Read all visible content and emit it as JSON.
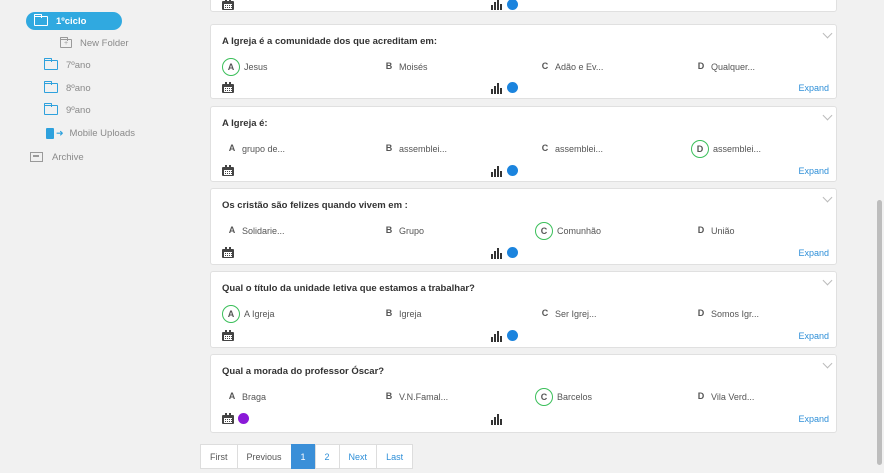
{
  "sidebar": {
    "active_folder": "1ºciclo",
    "items": [
      {
        "label": "New Folder",
        "icon": "folder-plus-icon"
      },
      {
        "label": "7ºano",
        "icon": "folder-icon"
      },
      {
        "label": "8ºano",
        "icon": "folder-icon"
      },
      {
        "label": "9ºano",
        "icon": "folder-icon"
      },
      {
        "label": "Mobile Uploads",
        "icon": "mobile-upload-icon"
      },
      {
        "label": "Archive",
        "icon": "archive-icon"
      }
    ]
  },
  "questions": [
    {
      "text": "A Igreja é a comunidade dos que acreditam em:",
      "options": [
        {
          "letter": "A",
          "text": "Jesus",
          "correct": true
        },
        {
          "letter": "B",
          "text": "Moisés",
          "correct": false
        },
        {
          "letter": "C",
          "text": "Adão e Ev...",
          "correct": false
        },
        {
          "letter": "D",
          "text": "Qualquer...",
          "correct": false
        }
      ],
      "status_dot": "blue",
      "expand": "Expand"
    },
    {
      "text": "A Igreja é:",
      "options": [
        {
          "letter": "A",
          "text": "grupo de...",
          "correct": false
        },
        {
          "letter": "B",
          "text": "assemblei...",
          "correct": false
        },
        {
          "letter": "C",
          "text": "assemblei...",
          "correct": false
        },
        {
          "letter": "D",
          "text": "assemblei...",
          "correct": true
        }
      ],
      "status_dot": "blue",
      "expand": "Expand"
    },
    {
      "text": "Os cristão são felizes quando vivem em :",
      "options": [
        {
          "letter": "A",
          "text": "Solidarie...",
          "correct": false
        },
        {
          "letter": "B",
          "text": "Grupo",
          "correct": false
        },
        {
          "letter": "C",
          "text": "Comunhão",
          "correct": true
        },
        {
          "letter": "D",
          "text": "União",
          "correct": false
        }
      ],
      "status_dot": "blue",
      "expand": "Expand"
    },
    {
      "text": "Qual o título da unidade letiva que estamos a trabalhar?",
      "options": [
        {
          "letter": "A",
          "text": "A Igreja",
          "correct": true
        },
        {
          "letter": "B",
          "text": "Igreja",
          "correct": false
        },
        {
          "letter": "C",
          "text": "Ser Igrej...",
          "correct": false
        },
        {
          "letter": "D",
          "text": "Somos Igr...",
          "correct": false
        }
      ],
      "status_dot": "blue",
      "expand": "Expand"
    },
    {
      "text": "Qual a morada do professor Óscar?",
      "options": [
        {
          "letter": "A",
          "text": "Braga",
          "correct": false
        },
        {
          "letter": "B",
          "text": "V.N.Famal...",
          "correct": false
        },
        {
          "letter": "C",
          "text": "Barcelos",
          "correct": true
        },
        {
          "letter": "D",
          "text": "Vila Verd...",
          "correct": false
        }
      ],
      "status_dot": "purple",
      "expand": "Expand"
    }
  ],
  "pagination": {
    "first": "First",
    "previous": "Previous",
    "pages": [
      "1",
      "2"
    ],
    "current": "1",
    "next": "Next",
    "last": "Last"
  },
  "colors": {
    "accent": "#30a9e0",
    "correct": "#3bbf5a",
    "dot_blue": "#1b84de",
    "dot_purple": "#8a19d8",
    "link": "#2e8fd8"
  }
}
